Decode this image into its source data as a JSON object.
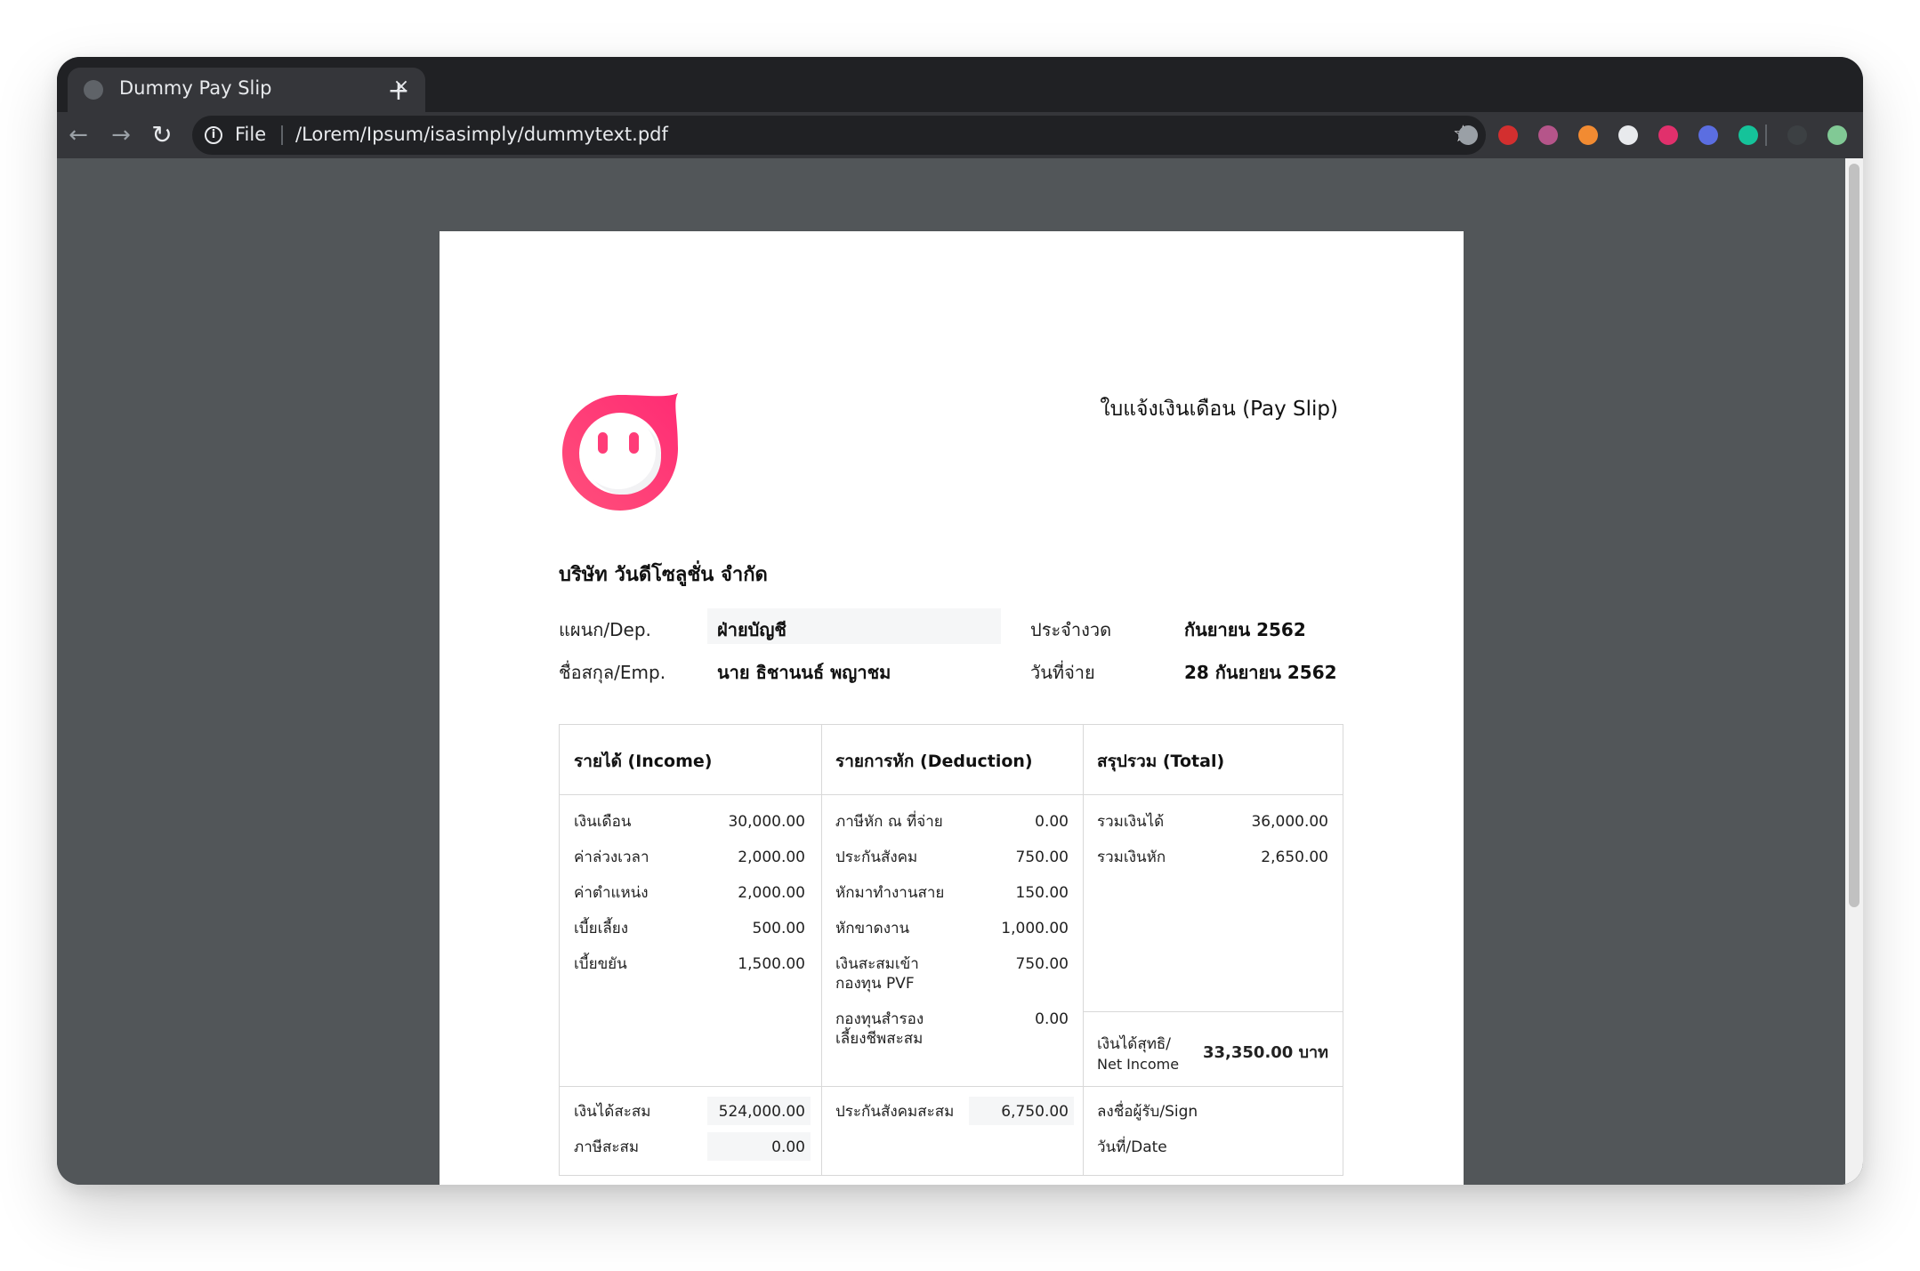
{
  "browser": {
    "tab_title": "Dummy Pay Slip",
    "close_symbol": "×",
    "new_tab_symbol": "+",
    "back_symbol": "←",
    "forward_symbol": "→",
    "reload_symbol": "↻",
    "info_symbol": "i",
    "scheme_label": "File",
    "url": "/Lorem/Ipsum/isasimply/dummytext.pdf",
    "star_symbol": "☆",
    "extensions": [
      {
        "name": "tab-manager-icon",
        "color": "#9aa0a6"
      },
      {
        "name": "adblock-plus-icon",
        "color": "#d32f2f"
      },
      {
        "name": "extension-record-icon",
        "color": "#b5558a"
      },
      {
        "name": "extension-orange-icon",
        "color": "#f28b32"
      },
      {
        "name": "extension-cloud-icon",
        "color": "#e8eaed"
      },
      {
        "name": "instagram-icon",
        "color": "#e1306c"
      },
      {
        "name": "extension-blue-icon",
        "color": "#5b6ee1"
      },
      {
        "name": "grammarly-icon",
        "color": "#15c39a"
      },
      {
        "name": "profile-avatar-icon",
        "color": "#3c4043"
      },
      {
        "name": "update-icon",
        "color": "#81c995"
      }
    ]
  },
  "doc": {
    "title": "ใบแจ้งเงินเดือน (Pay Slip)",
    "company": "บริษัท วันดีโซลูชั่น จำกัด",
    "dep_label": "แผนก/Dep.",
    "dep_value": "ฝ่ายบัญชี",
    "emp_label": "ชื่อสกุล/Emp.",
    "emp_value": "นาย ธิชานนธ์ พญาชม",
    "period_label": "ประจำงวด",
    "period_value": "กันยายน 2562",
    "paydate_label": "วันที่จ่าย",
    "paydate_value": "28 กันยายน 2562",
    "income_header": "รายได้ (Income)",
    "deduction_header": "รายการหัก (Deduction)",
    "total_header": "สรุปรวม (Total)",
    "income": [
      {
        "label": "เงินเดือน",
        "value": "30,000.00"
      },
      {
        "label": "ค่าล่วงเวลา",
        "value": "2,000.00"
      },
      {
        "label": "ค่าตำแหน่ง",
        "value": "2,000.00"
      },
      {
        "label": "เบี้ยเลี้ยง",
        "value": "500.00"
      },
      {
        "label": "เบี้ยขยัน",
        "value": "1,500.00"
      }
    ],
    "deduction": [
      {
        "label": "ภาษีหัก ณ ที่จ่าย",
        "value": "0.00"
      },
      {
        "label": "ประกันสังคม",
        "value": "750.00"
      },
      {
        "label": "หักมาทำงานสาย",
        "value": "150.00"
      },
      {
        "label": "หักขาดงาน",
        "value": "1,000.00"
      },
      {
        "label": "เงินสะสมเข้า",
        "label2": "กองทุน PVF",
        "value": "750.00"
      },
      {
        "label": "กองทุนสำรอง",
        "label2": "เลี้ยงชีพสะสม",
        "value": "0.00"
      }
    ],
    "total": [
      {
        "label": "รวมเงินได้",
        "value": "36,000.00"
      },
      {
        "label": "รวมเงินหัก",
        "value": "2,650.00"
      }
    ],
    "net_label": "เงินได้สุทธิ/",
    "net_label2": "Net Income",
    "net_value": "33,350.00 บาท",
    "ytd_income_label": "เงินได้สะสม",
    "ytd_income_value": "524,000.00",
    "ytd_tax_label": "ภาษีสะสม",
    "ytd_tax_value": "0.00",
    "ytd_ss_label": "ประกันสังคมสะสม",
    "ytd_ss_value": "6,750.00",
    "sign_label": "ลงชื่อผู้รับ/Sign",
    "date_label": "วันที่/Date"
  }
}
